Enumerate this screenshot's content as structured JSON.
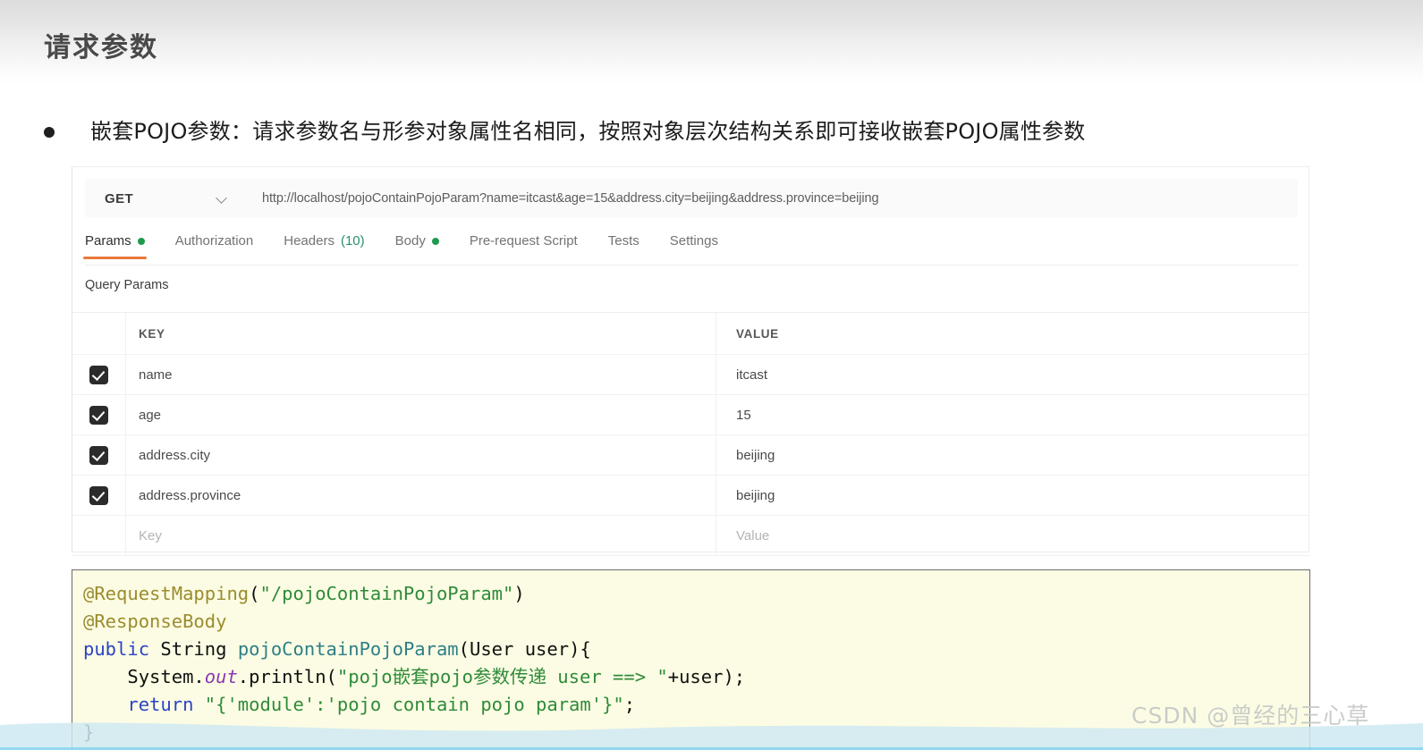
{
  "slide": {
    "title": "请求参数",
    "bullet": "嵌套POJO参数：请求参数名与形参对象属性名相同，按照对象层次结构关系即可接收嵌套POJO属性参数"
  },
  "postman": {
    "method": "GET",
    "url": "http://localhost/pojoContainPojoParam?name=itcast&age=15&address.city=beijing&address.province=beijing",
    "tabs": [
      {
        "label": "Params",
        "dot": true,
        "active": true
      },
      {
        "label": "Authorization",
        "dot": false,
        "active": false
      },
      {
        "label": "Headers",
        "count": "(10)",
        "dot": false,
        "active": false
      },
      {
        "label": "Body",
        "dot": true,
        "active": false
      },
      {
        "label": "Pre-request Script",
        "dot": false,
        "active": false
      },
      {
        "label": "Tests",
        "dot": false,
        "active": false
      },
      {
        "label": "Settings",
        "dot": false,
        "active": false
      }
    ],
    "section_label": "Query Params",
    "table": {
      "headers": {
        "key": "KEY",
        "value": "VALUE"
      },
      "rows": [
        {
          "checked": true,
          "key": "name",
          "value": "itcast"
        },
        {
          "checked": true,
          "key": "age",
          "value": "15"
        },
        {
          "checked": true,
          "key": "address.city",
          "value": "beijing"
        },
        {
          "checked": true,
          "key": "address.province",
          "value": "beijing"
        }
      ],
      "empty_row": {
        "key_placeholder": "Key",
        "value_placeholder": "Value"
      }
    }
  },
  "code": {
    "line1_ann": "@RequestMapping",
    "line1_open": "(",
    "line1_str": "\"/pojoContainPojoParam\"",
    "line1_close": ")",
    "line2_ann": "@ResponseBody",
    "line3_kw": "public",
    "line3_type": " String ",
    "line3_meth": "pojoContainPojoParam",
    "line3_args": "(User user){",
    "line4_a": "    System.",
    "line4_fld": "out",
    "line4_b": ".println(",
    "line4_str": "\"pojo嵌套pojo参数传递 user ==> \"",
    "line4_c": "+user);",
    "line5_kw": "    return ",
    "line5_str": "\"{'module':'pojo contain pojo param'}\"",
    "line5_c": ";",
    "line6": "}"
  },
  "watermark": "CSDN @曾经的三心草",
  "colors": {
    "accent_orange": "#e8793a",
    "dot_green": "#1f9a4d",
    "code_bg": "#fcfce4",
    "wave_blue": "#cfe9f2"
  }
}
